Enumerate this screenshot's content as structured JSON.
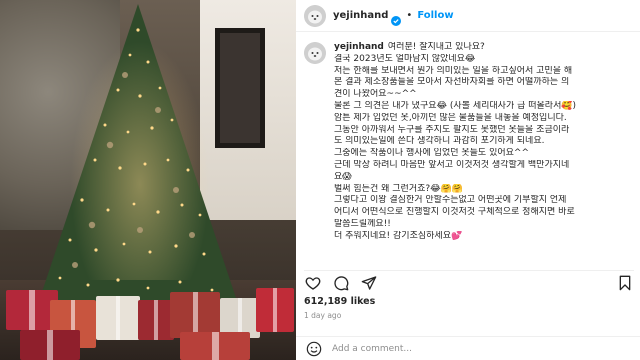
{
  "photo": {
    "alt_icon": "christmas-tree-photo"
  },
  "header": {
    "username": "yejinhand",
    "verified_icon": "verified-badge-icon",
    "separator": "•",
    "follow_label": "Follow"
  },
  "caption": {
    "username": "yejinhand",
    "lines": [
      "여러분! 잘지내고 있나요?",
      "결국 2023년도 얼마남지 않았네요😂",
      "저는 한해를 보내면서 뭔가 의미있는 일을 하고싶어서 고민을 해",
      "본 결과 제소장품들을 모아서 자선바자회를 하면 어떨까하는 의",
      "견이 나왔어요~~^^",
      "물론 그 의견은 내가 냈구요😂 (사볼 세리대사가 급 떠올라서🥰)",
      "암튼 제가 입었던 옷,아끼던 많은 물품들을 내놓을 예정입니다.",
      "그동안 아까워서 누구를 주지도 팔지도 못했던 옷들을 조금이라",
      "도 의미있는일에 쓴다 생각하니 과감히 포기하게 되네요.",
      "그중에는 작품이나 행사에 입었던 옷들도 있어요^^",
      "근데 막상 하려니 마음만 앞서고 이것저것 생각할게 백만가지네",
      "요😱",
      "벌써 힘든건 왜 그런거죠?😂🤗🤗",
      "그렇다고 이왕 결심한거 안할수는없고 어떤곳에 기부할지 언제",
      "어디서 어떤식으로 진행할지 이것저것 구체적으로 정해지면 바로",
      "말씀드릴께요!!",
      "더 추워지네요! 감기조심하세요💕"
    ]
  },
  "actions": {
    "like_icon": "heart-icon",
    "comment_icon": "comment-icon",
    "share_icon": "share-icon",
    "save_icon": "bookmark-icon"
  },
  "likes_text": "612,189 likes",
  "date_text": "1 day ago",
  "comment": {
    "emoji_icon": "emoji-icon",
    "placeholder": "Add a comment..."
  },
  "colors": {
    "link_blue": "#0095f6",
    "muted_text": "#8e8e8e",
    "text": "#262626"
  }
}
